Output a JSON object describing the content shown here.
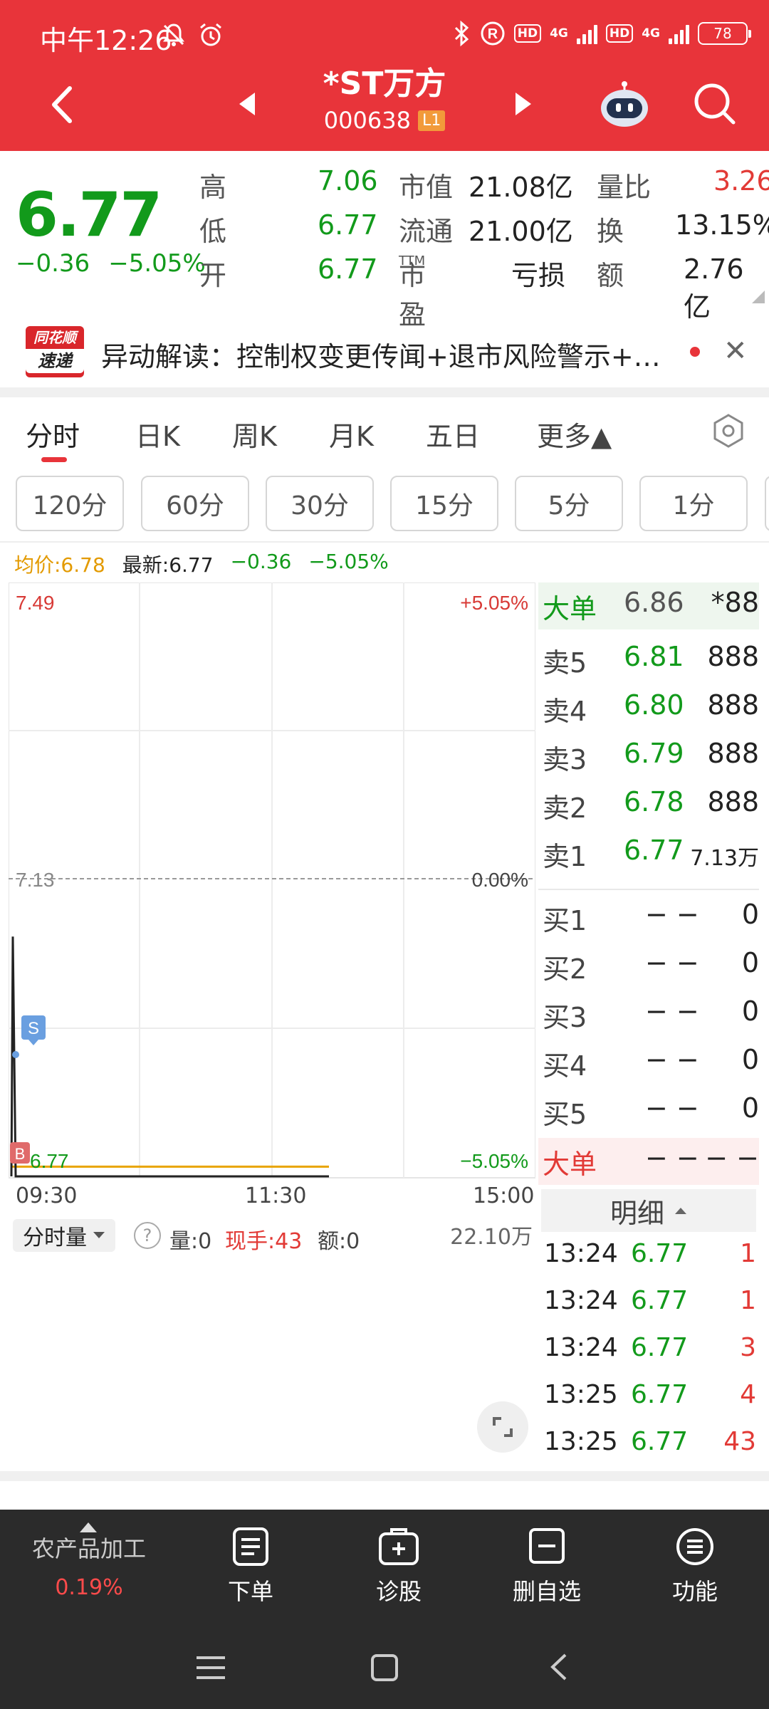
{
  "status_bar": {
    "time": "中午12:26",
    "net1": "4G",
    "net2": "4G",
    "hd": "HD",
    "battery": "78"
  },
  "header": {
    "stock_name": "*ST万方",
    "stock_code": "000638",
    "level_badge": "L1"
  },
  "quote": {
    "price": "6.77",
    "change": "−0.36",
    "change_pct": "−5.05%",
    "high_label": "高",
    "high": "7.06",
    "low_label": "低",
    "low": "6.77",
    "open_label": "开",
    "open": "6.77",
    "mcap_label": "市值",
    "mcap": "21.08亿",
    "float_label": "流通",
    "float": "21.00亿",
    "pe_label": "市盈",
    "pe_sup": "TTM",
    "pe": "亏损",
    "vol_ratio_label": "量比",
    "vol_ratio": "3.26",
    "turnover_label": "换",
    "turnover": "13.15%",
    "amount_label": "额",
    "amount": "2.76亿"
  },
  "news": {
    "logo_top": "同花顺",
    "logo_bottom": "速递",
    "text": "异动解读：控制权变更传闻+退市风险警示+…",
    "close": "✕"
  },
  "tabs": [
    {
      "label": "分时"
    },
    {
      "label": "日K"
    },
    {
      "label": "周K"
    },
    {
      "label": "月K"
    },
    {
      "label": "五日"
    },
    {
      "label": "更多▲"
    }
  ],
  "periods": [
    "120分",
    "60分",
    "30分",
    "15分",
    "5分",
    "1分"
  ],
  "info_line": {
    "avg": "均价:6.78",
    "latest": "最新:6.77",
    "chg": "−0.36",
    "pct": "−5.05%"
  },
  "chart_data": {
    "type": "line",
    "y_top": "7.49",
    "y_mid": "7.13",
    "y_bottom": "6.77",
    "pct_top": "+5.05%",
    "pct_mid": "0.00%",
    "pct_bottom": "−5.05%",
    "x_labels": [
      "09:30",
      "11:30",
      "15:00"
    ],
    "marker_s": "S",
    "marker_b": "B",
    "series": [
      {
        "name": "",
        "values": [
          6.77,
          7.06,
          6.77,
          6.77,
          6.77,
          6.77
        ]
      },
      {
        "name": "",
        "values": [
          6.78,
          6.78,
          6.78,
          6.78,
          6.78,
          6.78
        ]
      }
    ]
  },
  "order_book": {
    "big_top": {
      "label": "大单",
      "price": "6.86",
      "vol": "*88"
    },
    "asks": [
      {
        "label": "卖5",
        "price": "6.81",
        "vol": "888"
      },
      {
        "label": "卖4",
        "price": "6.80",
        "vol": "888"
      },
      {
        "label": "卖3",
        "price": "6.79",
        "vol": "888"
      },
      {
        "label": "卖2",
        "price": "6.78",
        "vol": "888"
      },
      {
        "label": "卖1",
        "price": "6.77",
        "vol": "7.13万"
      }
    ],
    "bids": [
      {
        "label": "买1",
        "price": "− −",
        "vol": "0"
      },
      {
        "label": "买2",
        "price": "− −",
        "vol": "0"
      },
      {
        "label": "买3",
        "price": "− −",
        "vol": "0"
      },
      {
        "label": "买4",
        "price": "− −",
        "vol": "0"
      },
      {
        "label": "买5",
        "price": "− −",
        "vol": "0"
      }
    ],
    "big_bottom": {
      "label": "大单",
      "price": "− −",
      "vol": "− −"
    }
  },
  "volume": {
    "selector": "分时量",
    "help": "?",
    "qty": "量:0",
    "hand": "现手:43",
    "amt": "额:0",
    "max": "22.10万"
  },
  "detail": {
    "title": "明细",
    "rows": [
      {
        "time": "13:24",
        "price": "6.77",
        "vol": "1"
      },
      {
        "time": "13:24",
        "price": "6.77",
        "vol": "1"
      },
      {
        "time": "13:24",
        "price": "6.77",
        "vol": "3"
      },
      {
        "time": "13:25",
        "price": "6.77",
        "vol": "4"
      },
      {
        "time": "13:25",
        "price": "6.77",
        "vol": "43"
      }
    ]
  },
  "bottom_bar": {
    "sector_name": "农产品加工",
    "sector_chg": "0.19%",
    "order": "下单",
    "diagnose": "诊股",
    "remove": "删自选",
    "functions": "功能"
  }
}
